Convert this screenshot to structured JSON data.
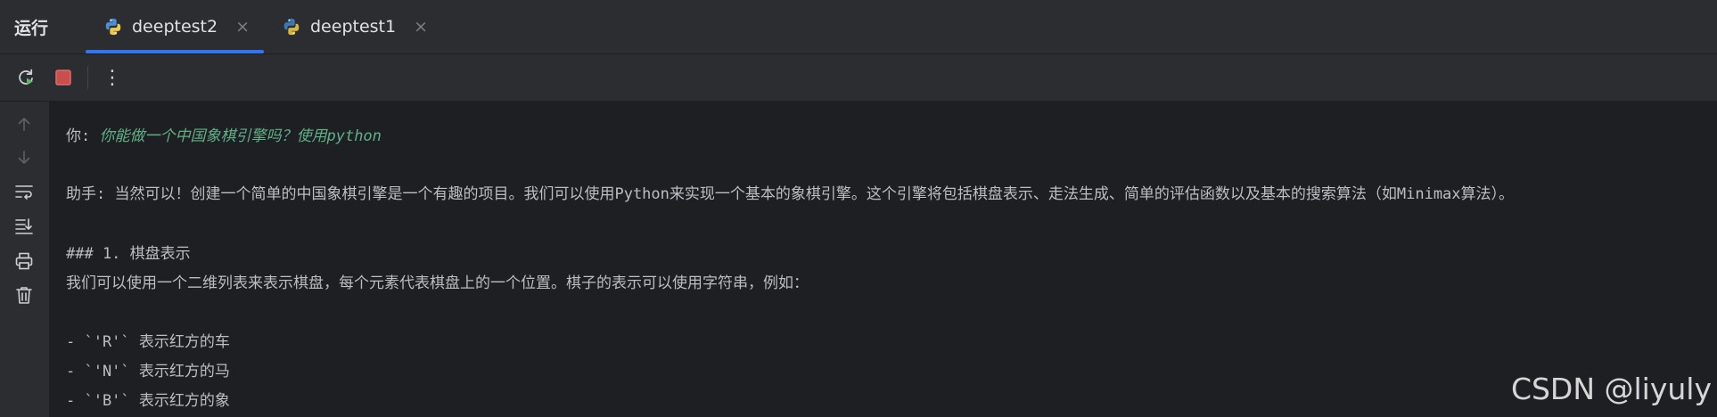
{
  "panel": {
    "title": "运行"
  },
  "tabs": [
    {
      "label": "deeptest2",
      "active": true,
      "icon": "python-icon",
      "close": "×"
    },
    {
      "label": "deeptest1",
      "active": false,
      "icon": "python-icon",
      "close": "×"
    }
  ],
  "toolbar": {
    "rerun_icon": "rerun-icon",
    "stop_icon": "stop-icon",
    "more_icon": "more-options-icon",
    "more_glyph": "⋮"
  },
  "gutter": {
    "icons": [
      "arrow-up-icon",
      "arrow-down-icon",
      "soft-wrap-icon",
      "scroll-to-end-icon",
      "print-icon",
      "trash-icon"
    ]
  },
  "console": {
    "user_prefix": "你: ",
    "user_question": "你能做一个中国象棋引擎吗？使用python",
    "assistant_line": "助手: 当然可以！创建一个简单的中国象棋引擎是一个有趣的项目。我们可以使用Python来实现一个基本的象棋引擎。这个引擎将包括棋盘表示、走法生成、简单的评估函数以及基本的搜索算法（如Minimax算法）。",
    "heading": "### 1. 棋盘表示",
    "desc": "我们可以使用一个二维列表来表示棋盘，每个元素代表棋盘上的一个位置。棋子的表示可以使用字符串，例如：",
    "items": [
      "- `'R'` 表示红方的车",
      "- `'N'` 表示红方的马",
      "- `'B'` 表示红方的象"
    ]
  },
  "watermark": "CSDN @liyuly",
  "colors": {
    "accent": "#3574f0",
    "user_text": "#5fb08a",
    "stop_red": "#db5c5c",
    "rerun_green": "#5fb865"
  }
}
